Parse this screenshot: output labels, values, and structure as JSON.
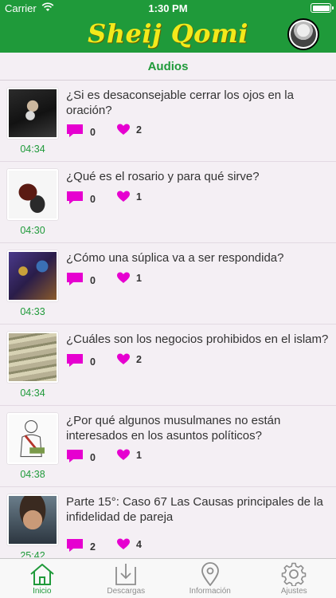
{
  "status_bar": {
    "carrier": "Carrier",
    "time": "1:30 PM"
  },
  "header": {
    "logo_text": "Sheij Qomi",
    "background": "#1f9a3a",
    "logo_color": "#f3e91b",
    "profile_icon": "profile-photo"
  },
  "section": {
    "title": "Audios"
  },
  "items": [
    {
      "title": "¿Si es desaconsejable cerrar los ojos en la oración?",
      "duration": "04:34",
      "comments": "0",
      "likes": "2"
    },
    {
      "title": "¿Qué es el rosario y para qué sirve?",
      "duration": "04:30",
      "comments": "0",
      "likes": "1"
    },
    {
      "title": "¿Cómo una súplica va a ser respondida?",
      "duration": "04:33",
      "comments": "0",
      "likes": "1"
    },
    {
      "title": "¿Cuáles son los negocios prohibidos en el islam?",
      "duration": "04:34",
      "comments": "0",
      "likes": "2"
    },
    {
      "title": "¿Por qué algunos musulmanes no están interesados en los asuntos políticos?",
      "duration": "04:38",
      "comments": "0",
      "likes": "1"
    },
    {
      "title": "Parte 15°: Caso 67 Las Causas principales de la infidelidad de pareja",
      "duration": "25:42",
      "comments": "2",
      "likes": "4"
    }
  ],
  "icons": {
    "comment": "comment-bubble-icon",
    "like": "heart-icon",
    "accent": "#e600d0"
  },
  "tabs": [
    {
      "label": "Inicio",
      "icon": "home-icon",
      "active": true
    },
    {
      "label": "Descargas",
      "icon": "download-icon",
      "active": false
    },
    {
      "label": "Información",
      "icon": "location-pin-icon",
      "active": false
    },
    {
      "label": "Ajustes",
      "icon": "gear-icon",
      "active": false
    }
  ]
}
